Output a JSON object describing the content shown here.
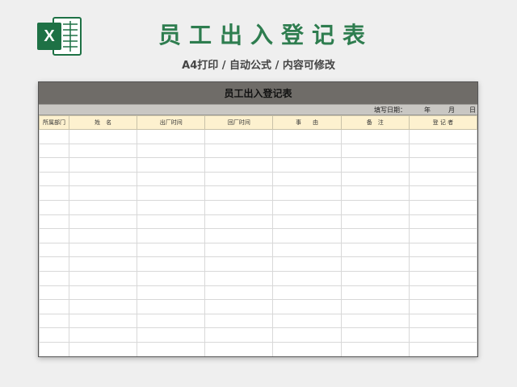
{
  "header": {
    "title": "员工出入登记表",
    "subtitle": "A4打印 / 自动公式 / 内容可修改",
    "logo_icon": "excel-icon",
    "logo_letter": "X",
    "brand_color": "#1e7145"
  },
  "sheet": {
    "title": "员工出入登记表",
    "fill_label": "填写日期：",
    "fill_year": "年",
    "fill_month": "月",
    "fill_day": "日",
    "columns": [
      "所属部门",
      "姓　名",
      "出厂时间",
      "回厂时间",
      "事　　由",
      "备　注",
      "登 记 者"
    ],
    "empty_rows": 16
  }
}
